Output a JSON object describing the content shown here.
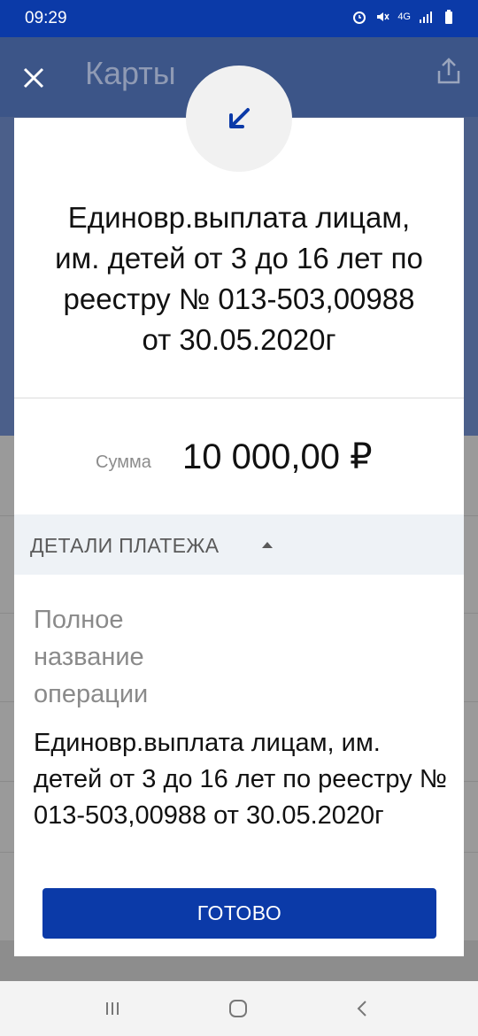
{
  "status_bar": {
    "time": "09:29",
    "network": "4G"
  },
  "background": {
    "title": "Карты"
  },
  "modal": {
    "direction_icon": "arrow-down-left-icon",
    "title": "Единовр.выплата лицам, им. детей от 3 до 16 лет по реестру № 013-503,00988 от 30.05.2020г",
    "sum_label": "Сумма",
    "sum_value": "10 000,00 ₽",
    "details_label": "ДЕТАЛИ ПЛАТЕЖА",
    "field_label": "Полное название операции",
    "field_value": "Единовр.выплата лицам, им. детей от 3 до 16 лет по реестру № 013-503,00988 от 30.05.2020г",
    "done_label": "ГОТОВО"
  },
  "colors": {
    "brand": "#0b3aa8",
    "details_bg": "#eef2f6"
  }
}
